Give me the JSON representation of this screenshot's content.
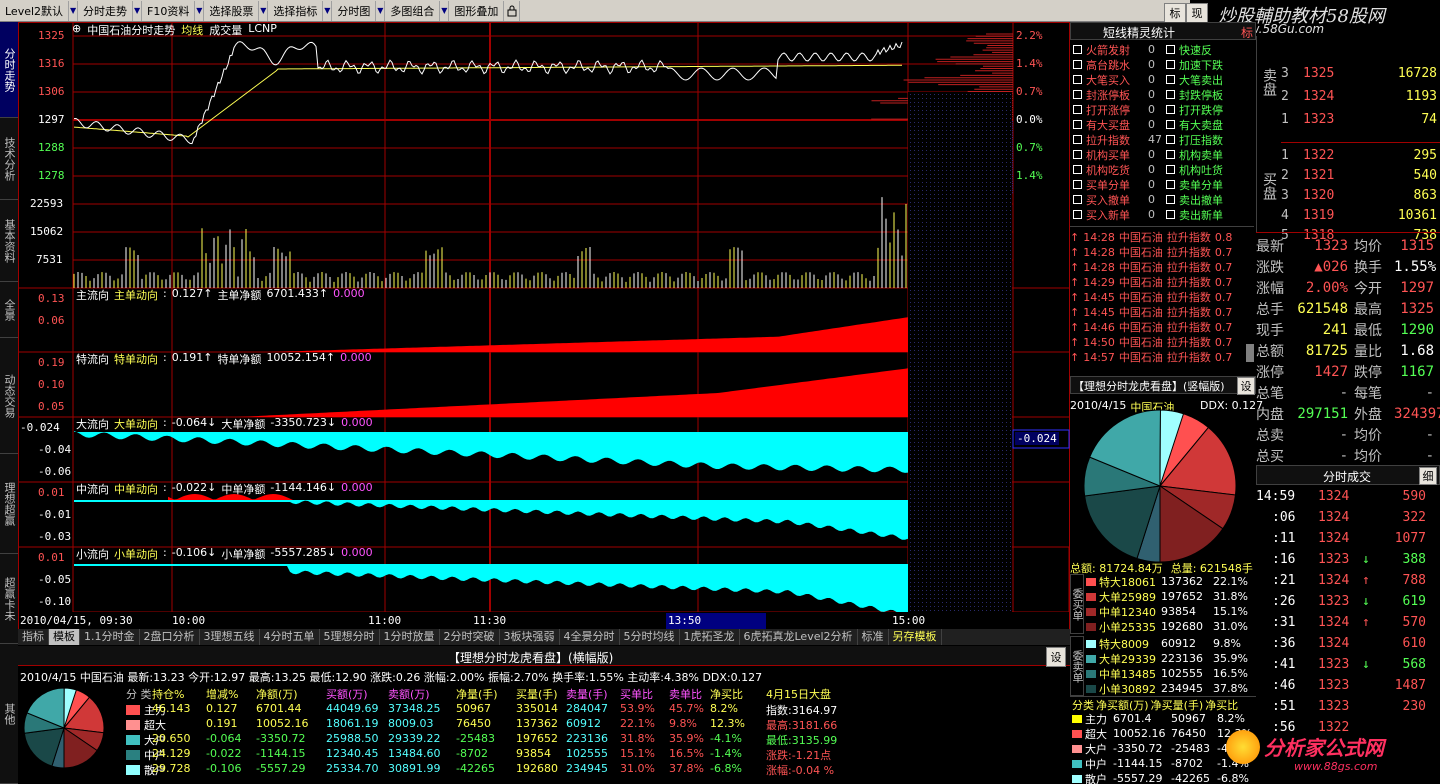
{
  "toolbar": {
    "items": [
      "Level2默认",
      "分时走势",
      "F10资料",
      "选择股票",
      "选择指标",
      "分时图",
      "多图组合",
      "图形叠加"
    ],
    "right_buttons": [
      "标",
      "现"
    ]
  },
  "watermark_top": {
    "line1": "炒股輔助教材58股网",
    "line2": "www.58Gu.com"
  },
  "watermark_bottom": {
    "line1": "分析家公式网",
    "line2": "www.88gs.com"
  },
  "left_tabs": [
    "分时走势",
    "技术分析",
    "基本资料",
    "全景",
    "动态交易",
    "理想超赢",
    "超赢卡未",
    "其他"
  ],
  "price_chart": {
    "title": "中国石油分时走势",
    "tags": [
      "均线",
      "成交量",
      "LCNP"
    ],
    "y_labels": [
      "1325",
      "1316",
      "1306",
      "1297",
      "1288",
      "1278"
    ],
    "pct_labels": [
      "2.2%",
      "1.4%",
      "0.7%",
      "0.0%",
      "0.7%",
      "1.4%"
    ],
    "volume_labels": [
      "22593",
      "15062",
      "7531"
    ],
    "colors": {
      "price": "#ffffff",
      "avg": "#ffff54",
      "up": "#ff3030",
      "down": "#54ff54"
    }
  },
  "indicators": [
    {
      "name": "主流向",
      "tag": "主单动向",
      "val": "0.127↑",
      "tag2": "主单净额",
      "val2": "6701.433↑",
      "tail": "0.000",
      "ylabels": [
        "0.13",
        "0.06"
      ],
      "color": "#ff0000"
    },
    {
      "name": "特流向",
      "tag": "特单动向",
      "val": "0.191↑",
      "tag2": "特单净额",
      "val2": "10052.154↑",
      "tail": "0.000",
      "ylabels": [
        "0.19",
        "0.10",
        "0.05"
      ],
      "color": "#ff0000"
    },
    {
      "name": "大流向",
      "tag": "大单动向",
      "val": "-0.064↓",
      "tag2": "大单净额",
      "val2": "-3350.723↓",
      "tail": "0.000",
      "ylabels": [
        "-0.024",
        "-0.04",
        "-0.06"
      ],
      "color": "#00ffff",
      "marker": "-0.024"
    },
    {
      "name": "中流向",
      "tag": "中单动向",
      "val": "-0.022↓",
      "tag2": "中单净额",
      "val2": "-1144.146↓",
      "tail": "0.000",
      "ylabels": [
        "0.01",
        "-0.01",
        "-0.03"
      ],
      "color": "#00ffff"
    },
    {
      "name": "小流向",
      "tag": "小单动向",
      "val": "-0.106↓",
      "tag2": "小单净额",
      "val2": "-5557.285↓",
      "tail": "0.000",
      "ylabels": [
        "0.01",
        "-0.05",
        "-0.10"
      ],
      "color": "#00ffff"
    }
  ],
  "time_axis": {
    "labels": [
      "2010/04/15, 09:30",
      "10:00",
      "11:00",
      "11:30",
      "13:50",
      "15:00"
    ]
  },
  "bottom_tabs": [
    "指标",
    "模板",
    "1.1分时金",
    "2盘口分析",
    "3理想五线",
    "4分时五单",
    "5理想分时",
    "1分时放量",
    "2分时突破",
    "3板块强弱",
    "4全景分时",
    "5分时均线",
    "1虎拓圣龙",
    "6虎拓真龙Level2分析",
    "标准",
    "另存模板"
  ],
  "sprite": {
    "title": "短线精灵统计",
    "left": [
      [
        "火箭发射",
        "0"
      ],
      [
        "高台跳水",
        "0"
      ],
      [
        "大笔买入",
        "0"
      ],
      [
        "封涨停板",
        "0"
      ],
      [
        "打开涨停",
        "0"
      ],
      [
        "有大买盘",
        "0"
      ],
      [
        "拉升指数",
        "47"
      ],
      [
        "机构买单",
        "0"
      ],
      [
        "机构吃货",
        "0"
      ],
      [
        "买单分单",
        "0"
      ],
      [
        "买入撤单",
        "0"
      ],
      [
        "买入新单",
        "0"
      ]
    ],
    "right": [
      "快速反",
      "加速下跌",
      "大笔卖出",
      "封跌停板",
      "打开跌停",
      "有大卖盘",
      "打压指数",
      "机构卖单",
      "机构吐货",
      "卖单分单",
      "卖出撤单",
      "卖出新单"
    ],
    "log": [
      [
        "14:28",
        "中国石油",
        "拉升指数",
        "0.8"
      ],
      [
        "14:28",
        "中国石油",
        "拉升指数",
        "0.7"
      ],
      [
        "14:28",
        "中国石油",
        "拉升指数",
        "0.7"
      ],
      [
        "14:29",
        "中国石油",
        "拉升指数",
        "0.7"
      ],
      [
        "14:45",
        "中国石油",
        "拉升指数",
        "0.7"
      ],
      [
        "14:45",
        "中国石油",
        "拉升指数",
        "0.7"
      ],
      [
        "14:46",
        "中国石油",
        "拉升指数",
        "0.7"
      ],
      [
        "14:50",
        "中国石油",
        "拉升指数",
        "0.7"
      ],
      [
        "14:57",
        "中国石油",
        "拉升指数",
        "0.7"
      ]
    ]
  },
  "pie_vertical": {
    "title": "【理想分时龙虎看盘】(竖幅版)",
    "setting": "设",
    "date": "2010/4/15",
    "name": "中国石油",
    "ddx": "DDX: 0.127",
    "total": "总额: 81724.84万",
    "total_vol": "总量: 621548手",
    "buy_label": "委买单",
    "sell_label": "委卖单",
    "buy_rows": [
      [
        "特大18061",
        "137362",
        "22.1%"
      ],
      [
        "大单25989",
        "197652",
        "31.8%"
      ],
      [
        "中单12340",
        "93854",
        "15.1%"
      ],
      [
        "小单25335",
        "192680",
        "31.0%"
      ]
    ],
    "sell_rows": [
      [
        "特大8009",
        "60912",
        "9.8%"
      ],
      [
        "大单29339",
        "223136",
        "35.9%"
      ],
      [
        "中单13485",
        "102555",
        "16.5%"
      ],
      [
        "小单30892",
        "234945",
        "37.8%"
      ]
    ],
    "class_header": [
      "分类",
      "净买额(万)",
      "净买量(手)",
      "净买比"
    ],
    "class_rows": [
      [
        "主力",
        "6701.4",
        "50967",
        "8.2%"
      ],
      [
        "超大",
        "10052.16",
        "76450",
        "12.3%"
      ],
      [
        "大户",
        "-3350.72",
        "-25483",
        "-4.1%"
      ],
      [
        "中户",
        "-1144.15",
        "-8702",
        "-1.4%"
      ],
      [
        "散户",
        "-5557.29",
        "-42265",
        "-6.8%"
      ]
    ]
  },
  "quotes": {
    "sell": [
      [
        "3",
        "1325",
        "16728"
      ],
      [
        "2",
        "1324",
        "1193"
      ],
      [
        "1",
        "1323",
        "74"
      ]
    ],
    "buy": [
      [
        "1",
        "1322",
        "295"
      ],
      [
        "2",
        "1321",
        "540"
      ],
      [
        "3",
        "1320",
        "863"
      ],
      [
        "4",
        "1319",
        "10361"
      ],
      [
        "5",
        "1318",
        "738"
      ]
    ],
    "sell_label": "卖盘",
    "buy_label": "买盘",
    "stats": [
      [
        "最新",
        "1323",
        "均价",
        "1315"
      ],
      [
        "涨跌",
        "▲026",
        "换手",
        "1.55%"
      ],
      [
        "涨幅",
        "2.00%",
        "今开",
        "1297"
      ],
      [
        "总手",
        "621548",
        "最高",
        "1325"
      ],
      [
        "现手",
        "241",
        "最低",
        "1290"
      ],
      [
        "总额",
        "81725",
        "量比",
        "1.68"
      ],
      [
        "涨停",
        "1427",
        "跌停",
        "1167"
      ],
      [
        "总笔",
        "-",
        "每笔",
        "-"
      ],
      [
        "内盘",
        "297151",
        "外盘",
        "324397"
      ],
      [
        "总卖",
        "-",
        "均价",
        "-"
      ],
      [
        "总买",
        "-",
        "均价",
        "-"
      ]
    ]
  },
  "trades": {
    "title": "分时成交",
    "button": "细",
    "rows": [
      [
        "14:59",
        "1324",
        "590",
        ""
      ],
      [
        ":06",
        "1324",
        "322",
        ""
      ],
      [
        ":11",
        "1324",
        "1077",
        ""
      ],
      [
        ":16",
        "1323",
        "388",
        "down"
      ],
      [
        ":21",
        "1324",
        "788",
        "up"
      ],
      [
        ":26",
        "1323",
        "619",
        "down"
      ],
      [
        ":31",
        "1324",
        "570",
        "up"
      ],
      [
        ":36",
        "1324",
        "610",
        ""
      ],
      [
        ":41",
        "1323",
        "568",
        "down"
      ],
      [
        ":46",
        "1323",
        "1487",
        ""
      ],
      [
        ":51",
        "1323",
        "230",
        ""
      ],
      [
        ":56",
        "1322",
        "",
        ""
      ]
    ]
  },
  "bottom_panel": {
    "title": "【理想分时龙虎看盘】(横幅版)",
    "setting": "设",
    "info": "2010/4/15 中国石油 最新:13.23 今开:12.97 最高:13.25 最低:12.90 涨跌:0.26 涨幅:2.00% 振幅:2.70% 换手率:1.55% 主动率:4.38% DDX:0.127",
    "headers": [
      "分 类",
      "持仓%",
      "增减%",
      "净额(万)",
      "买额(万)",
      "卖额(万)",
      "净量(手)",
      "买量(手)",
      "卖量(手)",
      "买单比",
      "卖单比",
      "净买比",
      "4月15日大盘"
    ],
    "rows": [
      [
        "主力",
        "46.143",
        "0.127",
        "6701.44",
        "44049.69",
        "37348.25",
        "50967",
        "335014",
        "284047",
        "53.9%",
        "45.7%",
        "8.2%",
        "指数:3164.97"
      ],
      [
        "超大",
        "",
        "0.191",
        "10052.16",
        "18061.19",
        "8009.03",
        "76450",
        "137362",
        "60912",
        "22.1%",
        "9.8%",
        "12.3%",
        "最高:3181.66"
      ],
      [
        "大户",
        "20.650",
        "-0.064",
        "-3350.72",
        "25988.50",
        "29339.22",
        "-25483",
        "197652",
        "223136",
        "31.8%",
        "35.9%",
        "-4.1%",
        "最低:3135.99"
      ],
      [
        "中户",
        "24.129",
        "-0.022",
        "-1144.15",
        "12340.45",
        "13484.60",
        "-8702",
        "93854",
        "102555",
        "15.1%",
        "16.5%",
        "-1.4%",
        "涨跌:-1.21点"
      ],
      [
        "散户",
        "29.728",
        "-0.106",
        "-5557.29",
        "25334.70",
        "30891.99",
        "-42265",
        "192680",
        "234945",
        "31.0%",
        "37.8%",
        "-6.8%",
        "涨幅:-0.04 %"
      ]
    ],
    "row_colors": [
      "#ff5050",
      "#ff9090",
      "#40c0c0",
      "#2a8080",
      "#90ffff"
    ]
  }
}
